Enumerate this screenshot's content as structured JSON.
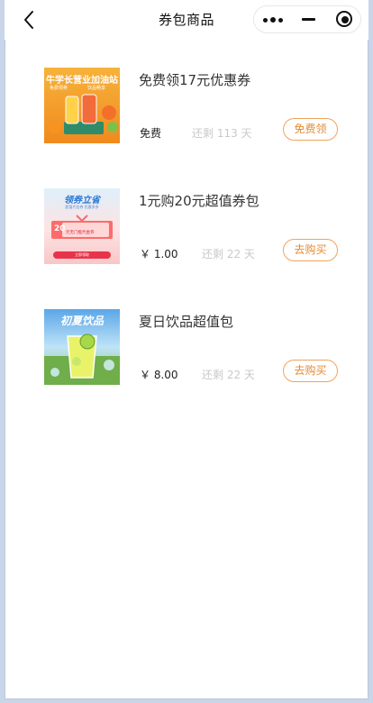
{
  "nav": {
    "title": "券包商品",
    "back_icon": "chevron-left-icon",
    "more_icon": "more-dots-icon",
    "minimize_icon": "minimize-icon",
    "close_icon": "target-close-icon"
  },
  "items": [
    {
      "name": "免费领17元优惠券",
      "price": "免费",
      "remaining": "还剩 113 天",
      "button": "免费领",
      "image": {
        "headline": "牛学长营业加油站",
        "line_left": "免费领券",
        "line_right": "饮品畅享"
      }
    },
    {
      "name": "1元购20元超值券包",
      "price": "￥ 1.00",
      "remaining": "还剩 22 天",
      "button": "去购买",
      "image": {
        "headline": "领券立省",
        "subline": "超值代金券 优惠多多",
        "amount": "20",
        "coupon_text": "元无门槛代金券",
        "cta": "立即领取"
      }
    },
    {
      "name": "夏日饮品超值包",
      "price": "￥ 8.00",
      "remaining": "还剩 22 天",
      "button": "去购买",
      "image": {
        "headline": "初夏饮品"
      }
    }
  ],
  "colors": {
    "accent": "#e58a32",
    "accent_border": "#f0a35b",
    "muted": "#c9c9c9",
    "outer_background": "#c9d6ea"
  }
}
